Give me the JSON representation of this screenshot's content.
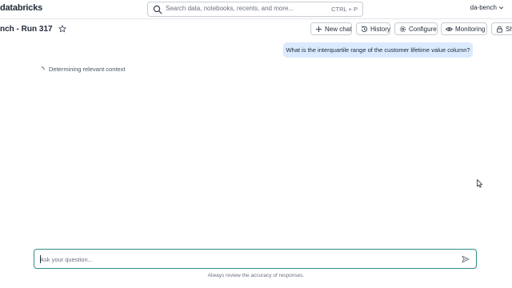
{
  "app": {
    "logo": "databricks"
  },
  "search": {
    "placeholder": "Search data, notebooks, recents, and more...",
    "shortcut": "CTRL + P"
  },
  "user": {
    "name": "da-bench"
  },
  "page": {
    "title": "nch - Run 317"
  },
  "toolbar": {
    "new_chat": "New chat",
    "history": "History",
    "configure": "Configure",
    "monitoring": "Monitoring",
    "share": "Sha"
  },
  "chat": {
    "user_message": "What is the interquartile range of the customer lifetime value column?",
    "status": "Determining relevant context"
  },
  "composer": {
    "placeholder": "Ask your question...",
    "disclaimer": "Always review the accuracy of responses."
  },
  "colors": {
    "accent": "#2f8f85",
    "user_bubble": "#dbeafe"
  }
}
